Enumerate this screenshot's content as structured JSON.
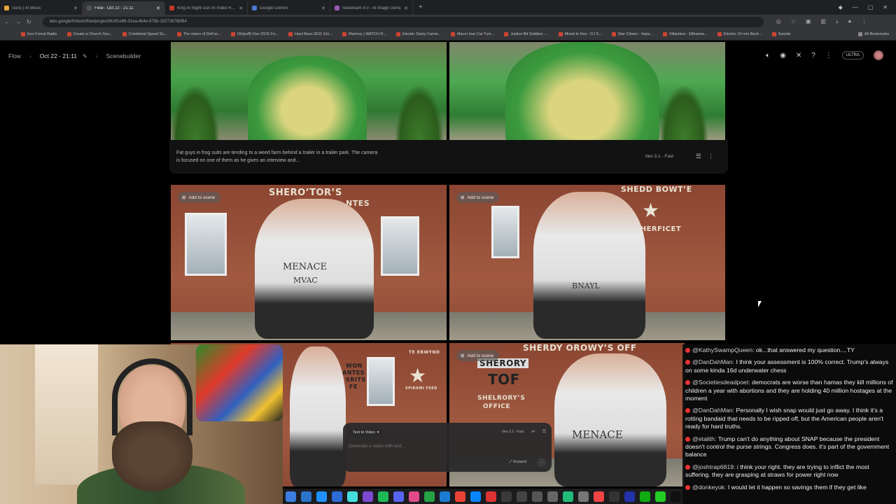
{
  "browser": {
    "tabs": [
      {
        "title": "Suno | AI Music",
        "color": "#e8a33c"
      },
      {
        "title": "Flow - Oct 22 - 21:11",
        "color": "#3b3b3b",
        "active": true
      },
      {
        "title": "King At Night Gun AI Video R...",
        "color": "#c0392b"
      },
      {
        "title": "Google Gemini",
        "color": "#4a7bd0"
      },
      {
        "title": "Seedream 4.0 - AI Image Gene...",
        "color": "#9b59b6"
      }
    ],
    "url": "labs.google/fx/tools/flow/project/9c4f1e86-31ea-4b4e-875b-15272876bf84",
    "bookmarks": [
      "Ezo Forest Radio",
      "Create a Church Sou...",
      "Combined Speed Sc...",
      "The return of DeFoo...",
      "Oh(puff) Oxe 20/11 Fo...",
      "Hard Bass 2011 (Un...",
      "Marmoy | WATCH D...",
      "Electric Daisy Carniv...",
      "Macro Inar Car Tuni...",
      "Justice Bit Soldiers -...",
      "Mixed to Key - DJ S...",
      "Star Citizen - Impa...",
      "Villainbox - Ellhasive...",
      "Electric 10 mm Back...",
      "Suicide"
    ],
    "all_bookmarks": "All Bookmarks"
  },
  "header": {
    "crumbs": [
      "Flow",
      "Oct 22 - 21:11",
      "Scenebuilder"
    ],
    "badge": "ULTRA"
  },
  "caption": {
    "text": "Fat guys in frog suits are tending to a weed farm behind a trailer in a trailer park. The camera is focused on one of them as he gives an interview and...",
    "model": "Veo 3.1 - Fast"
  },
  "cards": {
    "add_to_scene": "Add to scene",
    "sign1": "SHERO’TOR’S",
    "sign1b": "NTES",
    "shirt1": "MENACE",
    "shirt1b": "MVAC",
    "sign2": "SHEDD BOWT’E",
    "sign2b": "SHERFICET",
    "shirt2": "BNAYL",
    "sign3": "WON",
    "sign3b": "ANTES",
    "sign3c": "SRITS",
    "sign3d": "FE",
    "sign3e": "TE ERWYND",
    "sign3f": "SPIRAMI FEED",
    "sign4": "SHERDY OROWY’S OFF",
    "sign4b": "SHERORY",
    "sign4c": "TOF",
    "sign4d": "SHELRORY’S",
    "sign4e": "OFFICE",
    "shirt4": "MENACE"
  },
  "prompt": {
    "mode": "Text to Video",
    "model": "Veo 3.1 - Fast",
    "count": "x4",
    "placeholder": "Generate a video with text...",
    "expand": "Expand"
  },
  "chat": [
    {
      "user": "@KathySwampQueen:",
      "text": "ok...that answered my question....TY"
    },
    {
      "user": "@DanDahMan:",
      "text": "I think your assessment is 100% correct. Trump's always on some kinda 16d underwater chess"
    },
    {
      "user": "@Societiesdeadpoet:",
      "text": "democrats are worse than hamas they kill millions of children a year with abortions and they are holding 40 million hostages at the moment"
    },
    {
      "user": "@DanDahMan:",
      "text": "Personally I wish snap would just go away. I think it's a rotting bandaid that needs to be ripped off, but the American people aren't ready for hard truths."
    },
    {
      "user": "@etalith:",
      "text": "Trump can't do anything about SNAP because the president doesn't control the purse strings. Congress does. it's part of the government balance"
    },
    {
      "user": "@joshtrap6819:",
      "text": "i think your right. they are trying to inflict the most suffering. they are grasping at straws for power right now"
    },
    {
      "user": "@donkeyok:",
      "text": "I would let it happen so savings them if they get like"
    }
  ],
  "taskbar_colors": [
    "#3b7de0",
    "#2a73c9",
    "#1e90ff",
    "#2d6bd6",
    "#4dd",
    "#7b4ad0",
    "#1db954",
    "#5865f2",
    "#e04a8a",
    "#25a244",
    "#1c7bd0",
    "#ea4335",
    "#0a84ff",
    "#d33",
    "#3a3a3a",
    "#444",
    "#555",
    "#666",
    "#2b7",
    "#777",
    "#e44",
    "#333",
    "#23a",
    "#1a1",
    "#2c2",
    "#111"
  ]
}
